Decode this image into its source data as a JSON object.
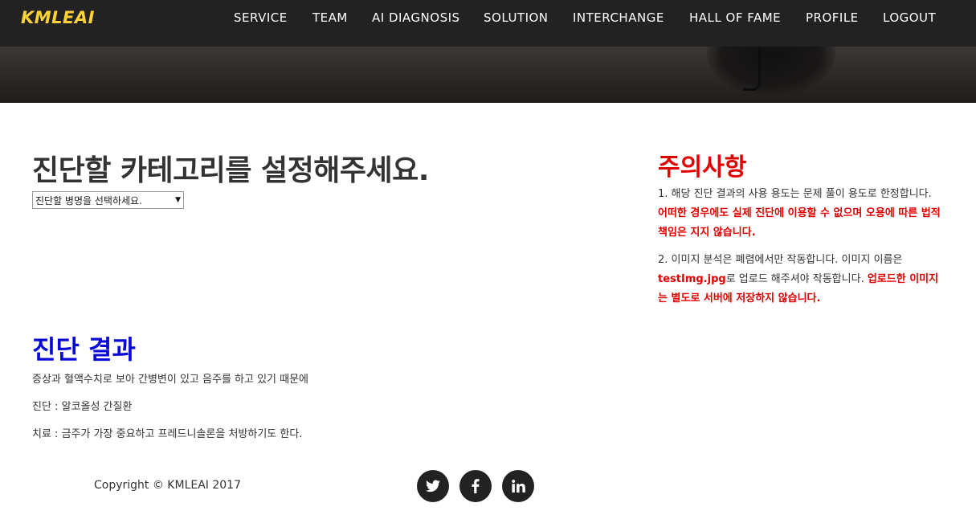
{
  "brand": "KMLEAI",
  "nav": {
    "items": [
      "SERVICE",
      "TEAM",
      "AI DIAGNOSIS",
      "SOLUTION",
      "INTERCHANGE",
      "HALL OF FAME",
      "PROFILE",
      "LOGOUT"
    ]
  },
  "main": {
    "heading": "진단할 카테고리를 설정해주세요.",
    "select_value": "진단할 병명을 선택하세요.",
    "result": {
      "heading": "진단 결과",
      "lines": [
        "증상과 혈액수치로 보아 간병변이 있고 음주를 하고 있기 때문에",
        "진단 : 알코올성 간질환",
        "치료 : 금주가 가장 중요하고 프레드니솔론을 처방하기도 한다."
      ]
    }
  },
  "notice": {
    "heading": "주의사항",
    "p1_normal": "1. 해당 진단 결과의 사용 용도는 문제 풀이 용도로 한정합니다. ",
    "p1_red": "어떠한 경우에도 실제 진단에 이용할 수 없으며 오용에 따른 법적책임은 지지 않습니다.",
    "p2_normal_a": "2. 이미지 분석은 폐렴에서만 작동합니다. 이미지 이름은 ",
    "p2_red_file": "testImg.jpg",
    "p2_normal_b": "로 업로드 해주셔야 작동합니다. ",
    "p2_red": "업로드한 이미지는 별도로 서버에 저장하지 않습니다."
  },
  "footer": {
    "copyright": "Copyright © KMLEAI 2017",
    "social": [
      "twitter-icon",
      "facebook-icon",
      "linkedin-icon"
    ]
  },
  "colors": {
    "accent": "#fed136",
    "nav_bg": "#222222",
    "notice_red": "#e00000",
    "result_blue": "#0a0ad8"
  }
}
